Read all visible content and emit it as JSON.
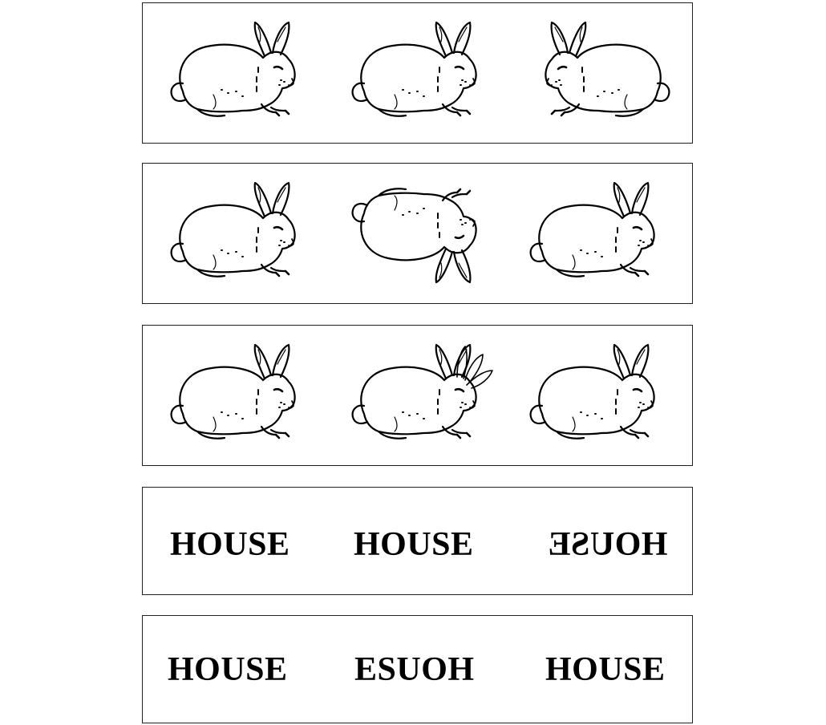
{
  "panels": [
    {
      "id": "panel-1",
      "kind": "rabbits",
      "items": [
        {
          "orientation": "facing-right"
        },
        {
          "orientation": "facing-right"
        },
        {
          "orientation": "facing-left"
        }
      ]
    },
    {
      "id": "panel-2",
      "kind": "rabbits",
      "items": [
        {
          "orientation": "facing-right"
        },
        {
          "orientation": "upside-down"
        },
        {
          "orientation": "facing-right"
        }
      ]
    },
    {
      "id": "panel-3",
      "kind": "rabbits",
      "items": [
        {
          "orientation": "facing-right"
        },
        {
          "orientation": "facing-right-extra-ears"
        },
        {
          "orientation": "facing-right"
        }
      ]
    },
    {
      "id": "panel-4",
      "kind": "words",
      "items": [
        {
          "text": "HOUSE",
          "style": "normal"
        },
        {
          "text": "HOUSE",
          "style": "normal"
        },
        {
          "text": "HOUSE",
          "style": "mirrored"
        }
      ]
    },
    {
      "id": "panel-5",
      "kind": "words",
      "items": [
        {
          "text": "HOUSE",
          "style": "normal"
        },
        {
          "text": "ESUOH",
          "style": "normal"
        },
        {
          "text": "HOUSE",
          "style": "normal"
        }
      ]
    }
  ],
  "colors": {
    "line": "#000000",
    "background": "#ffffff",
    "border": "#222222"
  }
}
